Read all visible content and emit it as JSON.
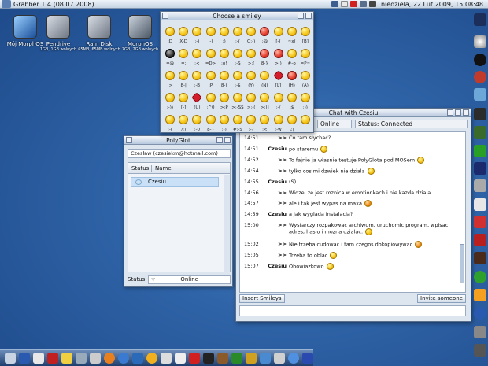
{
  "topbar": {
    "title": "Grabber 1.4 (08.07.2008)",
    "clock": "niedziela, 22 Lut 2009, 15:08:48"
  },
  "desktop": {
    "icons": [
      {
        "label": "Mój MorphOS",
        "sub": ""
      },
      {
        "label": "Pendrive",
        "sub": "1GB, 1GB wolnych"
      },
      {
        "label": "Ram Disk",
        "sub": "65MB, 65MB wolnych"
      },
      {
        "label": "MorphOS",
        "sub": "7GB, 2GB wolnych"
      }
    ]
  },
  "smiley_window": {
    "title": "Choose a smiley",
    "codes": [
      [
        ":D",
        "X-D",
        ":-)",
        ":-)",
        ":)",
        ":-(",
        "O:-)",
        ":@",
        "[-(",
        "~x(",
        "[B]"
      ],
      [
        "=@",
        "=;",
        ":<",
        "=D>",
        ":o!",
        ":-S",
        ">:[",
        "8-}",
        ">:)",
        "#-o",
        "=P~"
      ],
      [
        ":>",
        "8-|",
        ":-B",
        ":P",
        "8-)",
        ":-$",
        "(Y)",
        "(N)",
        "[L]",
        "(H)",
        "(A)"
      ],
      [
        ":-))",
        "[-]",
        "(U)",
        ":^0",
        ">:P",
        ">:-SS",
        ">:-(",
        ">:)]",
        ":-/",
        ":$",
        ":))"
      ],
      [
        ":-(",
        "/:)",
        ":-0",
        "8-}",
        ":-)",
        "#:-S",
        ":-?",
        ":<",
        ":-w",
        "\\:|",
        ""
      ]
    ]
  },
  "polyglot": {
    "title": "PolyGlot",
    "account": "Czesław (czesiekm@hotmail.com)",
    "columns": [
      "Status",
      "Name"
    ],
    "contacts": [
      {
        "name": "Czesiu"
      }
    ],
    "status_label": "Status",
    "status_value": "Online"
  },
  "chat": {
    "title": "Chat with Czesiu",
    "online": "Online",
    "status": "Status: Connected",
    "messages": [
      {
        "time": "14:51",
        "who": ">>",
        "text": "Co tam słychać?",
        "smiley": ""
      },
      {
        "time": "14:51",
        "who": "Czesiu",
        "text": "po staremu",
        "smiley": "yellow"
      },
      {
        "time": "14:52",
        "who": ">>",
        "text": "To fajnie ja własnie testuje PolyGlota pod MOSem",
        "smiley": "yellow"
      },
      {
        "time": "14:54",
        "who": ">>",
        "text": "tylko cos mi dzwiek nie dziala",
        "smiley": "yellow"
      },
      {
        "time": "14:55",
        "who": "Czesiu",
        "text": "(S)",
        "smiley": ""
      },
      {
        "time": "14:56",
        "who": ">>",
        "text": "Widze, ze jest roznica w emotionkach i nie kazda dziala",
        "smiley": ""
      },
      {
        "time": "14:57",
        "who": ">>",
        "text": "ale i tak jest wypas na maxa",
        "smiley": "orange"
      },
      {
        "time": "14:59",
        "who": "Czesiu",
        "text": "a jak wyglada instalacja?",
        "smiley": ""
      },
      {
        "time": "15:00",
        "who": ">>",
        "text": "Wystarczy rozpakowac archiwum, uruchomic program, wpisac adres, haslo i mozna dzialac.",
        "smiley": "yellow"
      },
      {
        "time": "15:02",
        "who": ">>",
        "text": "Nie trzeba cudowac i tam czegos dokopiowywac",
        "smiley": "orange"
      },
      {
        "time": "15:05",
        "who": ">>",
        "text": "Trzeba to oblac",
        "smiley": "yellow"
      },
      {
        "time": "15:07",
        "who": "Czesiu",
        "text": "Obowiazkowo",
        "smiley": "yellow"
      }
    ],
    "insert_smileys": "Insert Smileys",
    "invite": "Invite someone"
  }
}
